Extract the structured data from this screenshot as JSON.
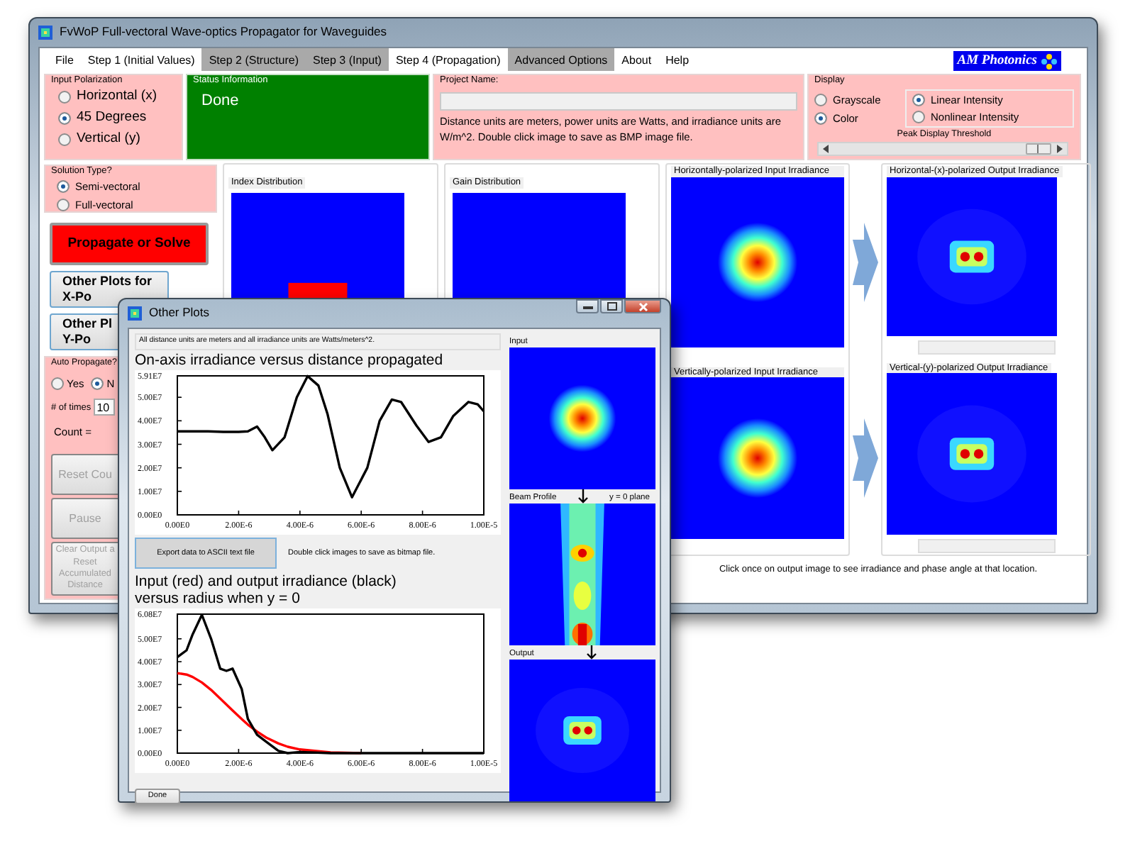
{
  "main_window": {
    "title": "FvWoP  Full-vectoral Wave-optics Propagator for Waveguides",
    "menu": [
      {
        "label": "File",
        "highlighted": false
      },
      {
        "label": "Step 1 (Initial Values)",
        "highlighted": false
      },
      {
        "label": "Step 2 (Structure)",
        "highlighted": true
      },
      {
        "label": "Step 3 (Input)",
        "highlighted": true
      },
      {
        "label": "Step 4 (Propagation)",
        "highlighted": false
      },
      {
        "label": "Advanced Options",
        "highlighted": true
      },
      {
        "label": "About",
        "highlighted": false
      },
      {
        "label": "Help",
        "highlighted": false
      }
    ],
    "logo": "AM Photonics",
    "input_polarization": {
      "title": "Input Polarization",
      "options": [
        {
          "label": "Horizontal (x)",
          "selected": false
        },
        {
          "label": "45 Degrees",
          "selected": true
        },
        {
          "label": "Vertical (y)",
          "selected": false
        }
      ]
    },
    "status": {
      "title": "Status Information",
      "text": "Done"
    },
    "project": {
      "title": "Project Name:",
      "note": "Distance units are meters, power units are Watts, and irradiance units are W/m^2.  Double click image to save as BMP image file."
    },
    "display": {
      "title": "Display",
      "color_mode": [
        {
          "label": "Grayscale",
          "selected": false
        },
        {
          "label": "Color",
          "selected": true
        }
      ],
      "intensity": [
        {
          "label": "Linear Intensity",
          "selected": true
        },
        {
          "label": "Nonlinear Intensity",
          "selected": false
        }
      ],
      "threshold": {
        "label": "Peak Display Threshold",
        "level": 0.93
      }
    },
    "solution_type": {
      "title": "Solution Type?",
      "options": [
        {
          "label": "Semi-vectoral",
          "selected": true
        },
        {
          "label": "Full-vectoral",
          "selected": false
        }
      ]
    },
    "buttons": [
      {
        "kind": "primary",
        "lines": [
          "Propagate or Solve"
        ]
      },
      {
        "kind": "plots",
        "lines": [
          "Other Plots for",
          "X-Po"
        ]
      },
      {
        "kind": "plots",
        "lines": [
          "Other Pl",
          "Y-Po"
        ]
      }
    ],
    "auto_propagate": {
      "title": "Auto Propagate?",
      "options": [
        {
          "label": "Yes",
          "selected": false
        },
        {
          "label": "N",
          "selected": true
        }
      ],
      "times_label": "# of times",
      "times_value": "10",
      "count_label": "Count =",
      "buttons": [
        {
          "lines": [
            "Reset Cou"
          ],
          "disabled": true
        },
        {
          "lines": [
            "Pause"
          ],
          "disabled": true
        },
        {
          "lines": [
            "Clear Output a",
            "Reset",
            "Accumulated",
            "Distance"
          ],
          "disabled": true
        }
      ]
    },
    "structure_images": [
      {
        "title": "Index Distribution",
        "kind": "index"
      },
      {
        "title": "Gain Distribution",
        "kind": "gain"
      }
    ],
    "input_images": [
      {
        "title": "Horizontally-polarized Input Irradiance"
      },
      {
        "title": "Vertically-polarized Input Irradiance"
      }
    ],
    "output_images": [
      {
        "title": "Horizontal-(x)-polarized Output Irradiance"
      },
      {
        "title": "Vertical-(y)-polarized Output Irradiance"
      }
    ],
    "hint": "Click once on output image to see irradiance and phase angle at that location."
  },
  "plots_window": {
    "title": "Other Plots",
    "note": "All distance units are meters and all irradiance units are Watts/meters^2.",
    "plots": [
      {
        "title": "On-axis irradiance versus distance propagated",
        "chart_data": {
          "type": "line",
          "x": [
            0,
            5e-07,
            1e-06,
            1.5e-06,
            2e-06,
            2.3e-06,
            2.6e-06,
            2.85e-06,
            3.1e-06,
            3.5e-06,
            3.9e-06,
            4.25e-06,
            4.6e-06,
            4.9e-06,
            5.3e-06,
            5.7e-06,
            6.2e-06,
            6.6e-06,
            7e-06,
            7.3e-06,
            7.8e-06,
            8.2e-06,
            8.6e-06,
            9e-06,
            9.5e-06,
            9.8e-06,
            1e-05
          ],
          "series": [
            {
              "color": "#000000",
              "values": [
                35500000.0,
                35500000.0,
                35500000.0,
                35300000.0,
                35300000.0,
                35500000.0,
                37500000.0,
                33000000.0,
                27500000.0,
                33000000.0,
                50000000.0,
                59000000.0,
                55000000.0,
                43000000.0,
                20000000.0,
                7500000.0,
                20000000.0,
                40000000.0,
                49000000.0,
                48000000.0,
                38000000.0,
                31000000.0,
                33000000.0,
                42000000.0,
                48000000.0,
                47000000.0,
                44000000.0
              ]
            }
          ],
          "xlim": [
            0,
            1e-05
          ],
          "ylim": [
            0,
            59100000.0
          ],
          "xticks": [
            {
              "value": 0,
              "label": "0.00E0"
            },
            {
              "value": 2e-06,
              "label": "2.00E-6"
            },
            {
              "value": 4e-06,
              "label": "4.00E-6"
            },
            {
              "value": 6e-06,
              "label": "6.00E-6"
            },
            {
              "value": 8e-06,
              "label": "8.00E-6"
            },
            {
              "value": 1e-05,
              "label": "1.00E-5"
            }
          ],
          "yticks": [
            {
              "value": 0,
              "label": "0.00E0"
            },
            {
              "value": 10000000.0,
              "label": "1.00E7"
            },
            {
              "value": 20000000.0,
              "label": "2.00E7"
            },
            {
              "value": 30000000.0,
              "label": "3.00E7"
            },
            {
              "value": 40000000.0,
              "label": "4.00E7"
            },
            {
              "value": 50000000.0,
              "label": "5.00E7"
            },
            {
              "value": 59100000.0,
              "label": "5.91E7"
            }
          ]
        }
      },
      {
        "title": "Input (red) and output irradiance (black) versus radius when y = 0",
        "chart_data": {
          "type": "line",
          "x": [
            0,
            3e-07,
            5e-07,
            8e-07,
            1.1e-06,
            1.4e-06,
            1.6e-06,
            1.8e-06,
            2.1e-06,
            2.3e-06,
            2.6e-06,
            2.9e-06,
            3.3e-06,
            3.6e-06,
            4e-06,
            5e-06,
            6e-06,
            7e-06,
            8e-06,
            9e-06,
            1e-05
          ],
          "series": [
            {
              "color": "#ff0000",
              "values": [
                35000000.0,
                34400000.0,
                33300000.0,
                30900000.0,
                27700000.0,
                23900000.0,
                21300000.0,
                18700000.0,
                14900000.0,
                12500000.0,
                9400000.0,
                6800000.0,
                4200000.0,
                2800000.0,
                1600000.0,
                300000.0,
                0,
                null,
                null,
                null,
                null
              ]
            },
            {
              "color": "#000000",
              "values": [
                42000000.0,
                45000000.0,
                52000000.0,
                60500000.0,
                50000000.0,
                37000000.0,
                36000000.0,
                37000000.0,
                28000000.0,
                15000000.0,
                8000000.0,
                5000000.0,
                1000000.0,
                0,
                500000.0,
                0,
                0,
                0,
                0,
                0,
                0
              ]
            }
          ],
          "xlim": [
            0,
            1e-05
          ],
          "ylim": [
            0,
            60800000.0
          ],
          "xticks": [
            {
              "value": 0,
              "label": "0.00E0"
            },
            {
              "value": 2e-06,
              "label": "2.00E-6"
            },
            {
              "value": 4e-06,
              "label": "4.00E-6"
            },
            {
              "value": 6e-06,
              "label": "6.00E-6"
            },
            {
              "value": 8e-06,
              "label": "8.00E-6"
            },
            {
              "value": 1e-05,
              "label": "1.00E-5"
            }
          ],
          "yticks": [
            {
              "value": 0,
              "label": "0.00E0"
            },
            {
              "value": 10000000.0,
              "label": "1.00E7"
            },
            {
              "value": 20000000.0,
              "label": "2.00E7"
            },
            {
              "value": 30000000.0,
              "label": "3.00E7"
            },
            {
              "value": 40000000.0,
              "label": "4.00E7"
            },
            {
              "value": 50000000.0,
              "label": "5.00E7"
            },
            {
              "value": 60800000.0,
              "label": "6.08E7"
            }
          ]
        }
      }
    ],
    "export_button": "Export data to ASCII text file",
    "save_hint": "Double click images to save as bitmap file.",
    "done_button": "Done",
    "images": [
      {
        "label": "Input",
        "kind": "input"
      },
      {
        "label": "Beam Profile",
        "side_label": "y = 0 plane",
        "kind": "profile"
      },
      {
        "label": "Output",
        "kind": "output"
      }
    ]
  }
}
